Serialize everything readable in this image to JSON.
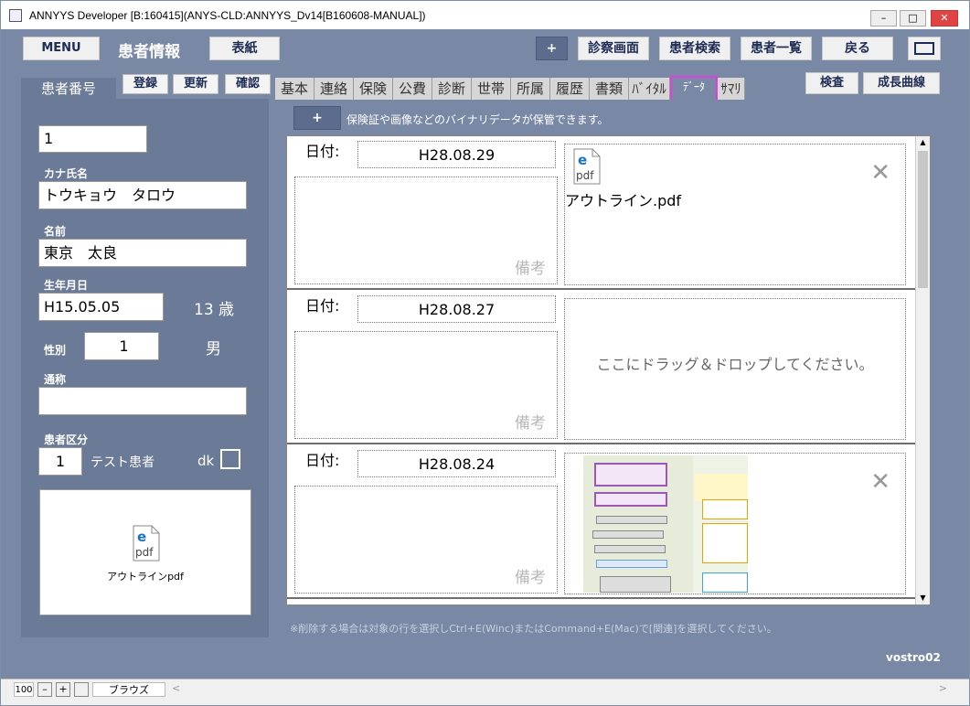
{
  "window": {
    "title": "ANNYYS Developer [B:160415](ANYS-CLD:ANNYYS_Dv14[B160608-MANUAL])"
  },
  "topbar": {
    "menu_label": "MENU",
    "page_title": "患者情報",
    "cover_label": "表紙",
    "plus_label": "+",
    "exam_screen_label": "診察画面",
    "patient_search_label": "患者検索",
    "patient_list_label": "患者一覧",
    "back_label": "戻る"
  },
  "left": {
    "tab_label": "患者番号",
    "register_label": "登録",
    "update_label": "更新",
    "confirm_label": "確認",
    "patient_number": "1",
    "kana_label": "カナ氏名",
    "kana_value": "トウキョウ　タロウ",
    "name_label": "名前",
    "name_value": "東京　太良",
    "dob_label": "生年月日",
    "dob_value": "H15.05.05",
    "age_text": "13 歳",
    "sex_label": "性別",
    "sex_value": "1",
    "sex_text": "男",
    "alias_label": "通称",
    "alias_value": "",
    "category_label": "患者区分",
    "category_value": "1",
    "category_text": "テスト患者",
    "dk_label": "dk",
    "preview_file": "アウトラインpdf"
  },
  "tabs": [
    "基本",
    "連絡",
    "保険",
    "公費",
    "診断",
    "世帯",
    "所属",
    "履歴",
    "書類",
    "ﾊﾞｲﾀﾙ",
    "ﾃﾞｰﾀ",
    "ｻﾏﾘ"
  ],
  "right_buttons": {
    "exam_label": "検査",
    "growth_label": "成長曲線"
  },
  "data_panel": {
    "add_label": "+",
    "info_text": "保険証や画像などのバイナリデータが保管できます。",
    "records": [
      {
        "date_label": "日付:",
        "date": "H28.08.29",
        "note_placeholder": "備考",
        "file_name": "アウトライン.pdf",
        "drop_text": ""
      },
      {
        "date_label": "日付:",
        "date": "H28.08.27",
        "note_placeholder": "備考",
        "file_name": "",
        "drop_text": "ここにドラッグ＆ドロップしてください。"
      },
      {
        "date_label": "日付:",
        "date": "H28.08.24",
        "note_placeholder": "備考",
        "file_name": "",
        "drop_text": ""
      }
    ],
    "footnote": "※削除する場合は対象の行を選択しCtrl+E(Winc)またはCommand+E(Mac)で[関連]を選択してください。"
  },
  "footer": {
    "machine": "vostro02"
  },
  "statusbar": {
    "zoom": "100",
    "mode": "ブラウズ"
  }
}
